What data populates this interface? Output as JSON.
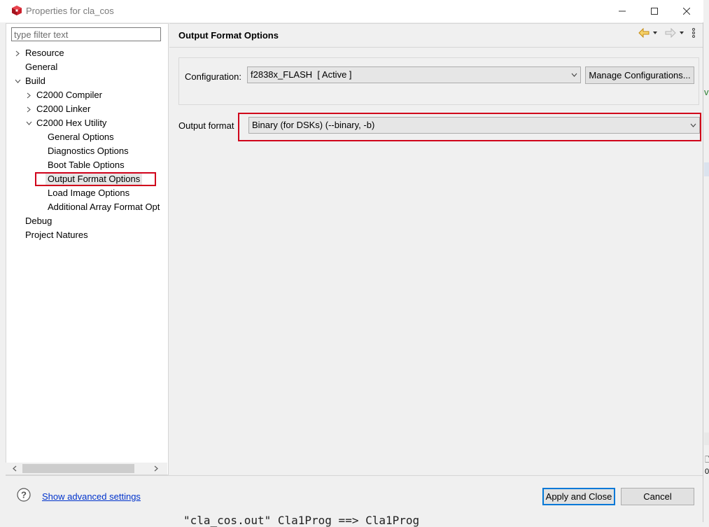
{
  "window": {
    "title": "Properties for cla_cos"
  },
  "filter": {
    "placeholder": "type filter text"
  },
  "tree": {
    "items": [
      {
        "label": "Resource",
        "arrow": "collapsed"
      },
      {
        "label": "General",
        "arrow": "none"
      },
      {
        "label": "Build",
        "arrow": "expanded"
      },
      {
        "label": "C2000 Compiler",
        "arrow": "collapsed"
      },
      {
        "label": "C2000 Linker",
        "arrow": "collapsed"
      },
      {
        "label": "C2000 Hex Utility",
        "arrow": "expanded"
      },
      {
        "label": "General Options",
        "arrow": "none"
      },
      {
        "label": "Diagnostics Options",
        "arrow": "none"
      },
      {
        "label": "Boot Table Options",
        "arrow": "none"
      },
      {
        "label": "Output Format Options",
        "arrow": "none",
        "selected": true
      },
      {
        "label": "Load Image Options",
        "arrow": "none"
      },
      {
        "label": "Additional Array Format Opt",
        "arrow": "none"
      },
      {
        "label": "Debug",
        "arrow": "none"
      },
      {
        "label": "Project Natures",
        "arrow": "none"
      }
    ]
  },
  "page": {
    "title": "Output Format Options",
    "configuration_label": "Configuration:",
    "configuration_value": "f2838x_FLASH  [ Active ]",
    "manage_button": "Manage Configurations...",
    "output_format_label": "Output format",
    "output_format_value": "Binary (for DSKs) (--binary, -b)"
  },
  "footer": {
    "advanced_link": "Show advanced settings",
    "apply_button": "Apply and Close",
    "cancel_button": "Cancel"
  },
  "background": {
    "code_text": "\"cla_cos.out\" Cla1Prog ==> Cla1Prog",
    "side_letter": "v",
    "side_glyph_1": "🗋",
    "side_glyph_2": "0"
  },
  "colors": {
    "highlight_red": "#d0021b",
    "link_blue": "#0033cc",
    "accent_blue": "#0078d7"
  },
  "icons": {
    "app": "app-logo-icon",
    "help": "help-icon",
    "back": "back-arrow-icon",
    "forward": "forward-arrow-icon",
    "menu": "view-menu-icon"
  }
}
